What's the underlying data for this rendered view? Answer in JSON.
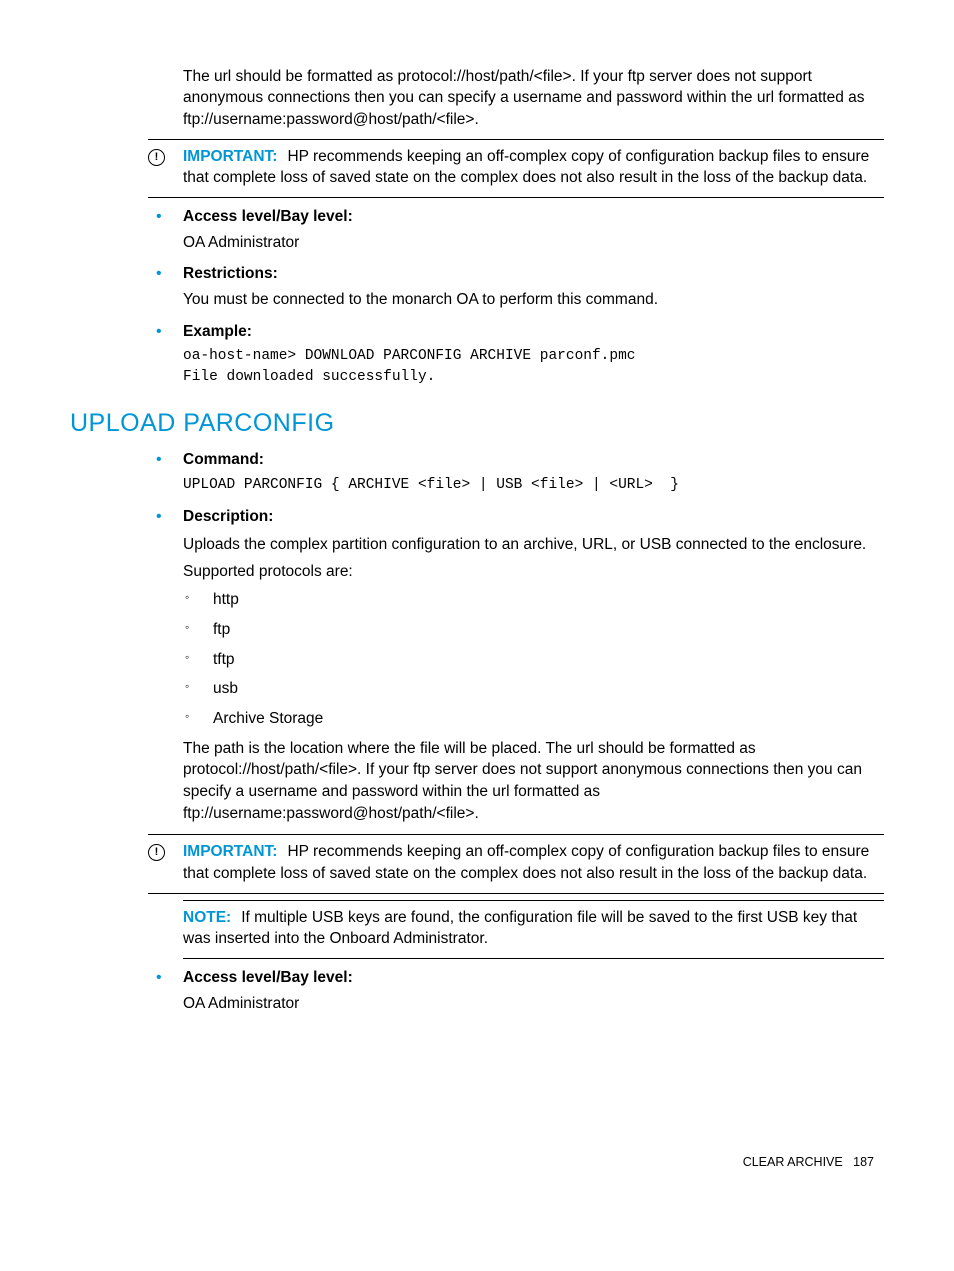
{
  "intro": "The url should be formatted as protocol://host/path/<file>. If your ftp server does not support anonymous connections then you can specify a username and password within the url formatted as ftp://username:password@host/path/<file>.",
  "callout1": {
    "label": "IMPORTANT:",
    "text": "HP recommends keeping an off-complex copy of configuration backup files to ensure that complete loss of saved state on the complex does not also result in the loss of the backup data."
  },
  "list1": {
    "access": {
      "label": "Access level/Bay level:",
      "body": "OA Administrator"
    },
    "restrictions": {
      "label": "Restrictions:",
      "body": "You must be connected to the monarch OA to perform this command."
    },
    "example": {
      "label": "Example:",
      "code": "oa-host-name> DOWNLOAD PARCONFIG ARCHIVE parconf.pmc\nFile downloaded successfully."
    }
  },
  "section_heading": "UPLOAD PARCONFIG",
  "list2": {
    "command": {
      "label": "Command:",
      "code": "UPLOAD PARCONFIG { ARCHIVE <file> | USB <file> | <URL>  }"
    },
    "description": {
      "label": "Description:",
      "para1": "Uploads the complex partition configuration to an archive, URL, or USB connected to the enclosure.",
      "para2": "Supported protocols are:",
      "protocols": [
        "http",
        "ftp",
        "tftp",
        "usb",
        "Archive Storage"
      ],
      "para3": "The path is the location where the file will be placed. The url should be formatted as protocol://host/path/<file>. If your ftp server does not support anonymous connections then you can specify a username and password within the url formatted as ftp://username:password@host/path/<file>."
    }
  },
  "callout2": {
    "label": "IMPORTANT:",
    "text": "HP recommends keeping an off-complex copy of configuration backup files to ensure that complete loss of saved state on the complex does not also result in the loss of the backup data."
  },
  "note": {
    "label": "NOTE:",
    "text": "If multiple USB keys are found, the configuration file will be saved to the first USB key that was inserted into the Onboard Administrator."
  },
  "list3": {
    "access": {
      "label": "Access level/Bay level:",
      "body": "OA Administrator"
    }
  },
  "footer": {
    "section": "CLEAR ARCHIVE",
    "page": "187"
  }
}
